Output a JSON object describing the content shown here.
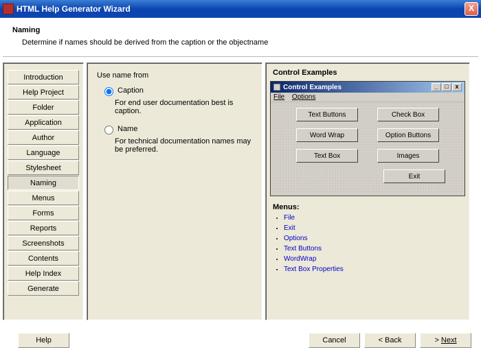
{
  "titlebar": {
    "title": "HTML Help Generator Wizard",
    "close": "X"
  },
  "header": {
    "title": "Naming",
    "description": "Determine if names should be derived from the caption or the objectname"
  },
  "sidebar": {
    "items": [
      {
        "label": "Introduction",
        "active": false
      },
      {
        "label": "Help Project",
        "active": false
      },
      {
        "label": "Folder",
        "active": false
      },
      {
        "label": "Application",
        "active": false
      },
      {
        "label": "Author",
        "active": false
      },
      {
        "label": "Language",
        "active": false
      },
      {
        "label": "Stylesheet",
        "active": false
      },
      {
        "label": "Naming",
        "active": true
      },
      {
        "label": "Menus",
        "active": false
      },
      {
        "label": "Forms",
        "active": false
      },
      {
        "label": "Reports",
        "active": false
      },
      {
        "label": "Screenshots",
        "active": false
      },
      {
        "label": "Contents",
        "active": false
      },
      {
        "label": "Help Index",
        "active": false
      },
      {
        "label": "Generate",
        "active": false
      }
    ]
  },
  "options": {
    "heading": "Use name from",
    "caption_label": "Caption",
    "caption_desc": "For end user documentation best is caption.",
    "name_label": "Name",
    "name_desc": "For technical documentation names may be preferred.",
    "selected": "caption"
  },
  "example": {
    "section_title": "Control Examples",
    "window_title": "Control Examples",
    "menu": {
      "file": "File",
      "options": "Options"
    },
    "buttons": {
      "text_buttons": "Text Buttons",
      "check_box": "Check Box",
      "word_wrap": "Word Wrap",
      "option_buttons": "Option Buttons",
      "text_box": "Text Box",
      "images": "Images",
      "exit": "Exit"
    }
  },
  "menus_section": {
    "title": "Menus:",
    "items": [
      "File",
      "Exit",
      "Options",
      "Text Buttons",
      "WordWrap",
      "Text Box Properties"
    ]
  },
  "footer": {
    "help": "Help",
    "cancel": "Cancel",
    "back": "< Back",
    "next_prefix": "> ",
    "next_label": "Next"
  }
}
